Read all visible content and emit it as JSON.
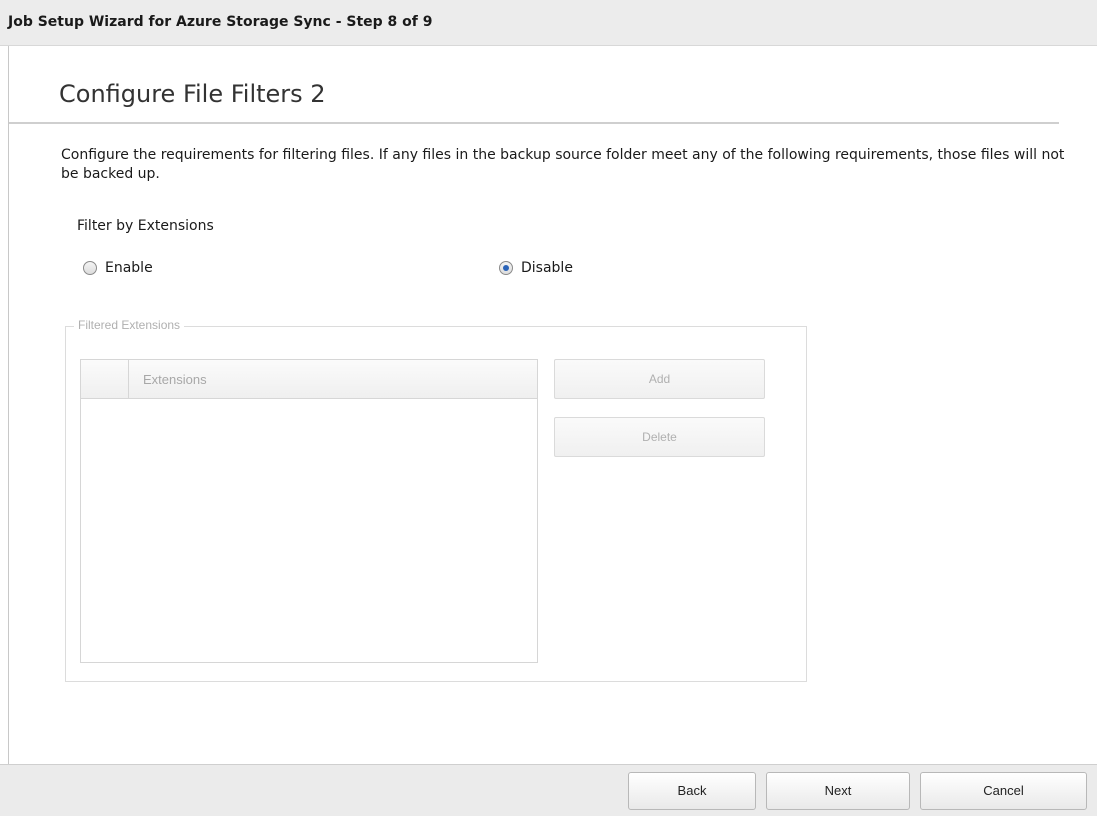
{
  "window": {
    "title": "Job Setup Wizard for Azure Storage Sync - Step 8 of 9"
  },
  "page": {
    "heading": "Configure File Filters 2",
    "description": "Configure the requirements for filtering files. If any files in the backup source folder meet any of the following requirements, those files will not be backed up."
  },
  "filter_by_extensions": {
    "label": "Filter by Extensions",
    "options": [
      {
        "label": "Enable",
        "selected": false
      },
      {
        "label": "Disable",
        "selected": true
      }
    ]
  },
  "filtered_extensions": {
    "legend": "Filtered Extensions",
    "column_header": "Extensions",
    "rows": [],
    "add_label": "Add",
    "delete_label": "Delete",
    "enabled": false
  },
  "footer": {
    "back_label": "Back",
    "next_label": "Next",
    "cancel_label": "Cancel"
  },
  "colors": {
    "radio_selected": "#2a63b8",
    "disabled_text": "#b0b0b0"
  }
}
